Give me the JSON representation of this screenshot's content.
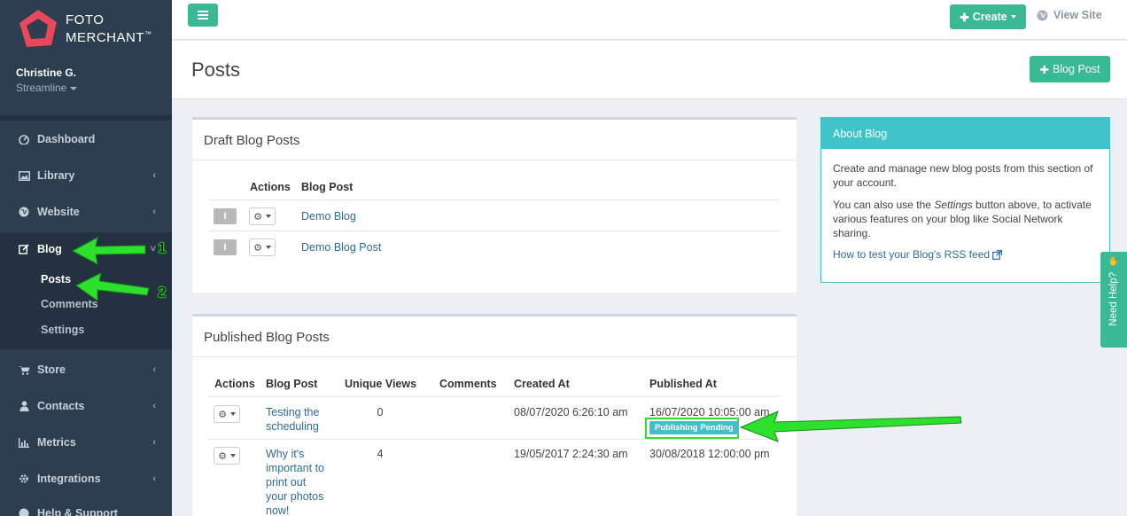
{
  "brand": {
    "line1": "FOTO",
    "line2": "MERCHANT",
    "tm": "™",
    "color": "#e8485a"
  },
  "user": {
    "name": "Christine G.",
    "plan": "Streamline"
  },
  "sidebar": {
    "items": [
      {
        "label": "Dashboard",
        "icon": "dashboard-icon",
        "chevron": ""
      },
      {
        "label": "Library",
        "icon": "picture-icon",
        "chevron": "‹"
      },
      {
        "label": "Website",
        "icon": "globe-icon",
        "chevron": "‹"
      },
      {
        "label": "Blog",
        "icon": "edit-icon",
        "chevron": "˅"
      },
      {
        "label": "Store",
        "icon": "cart-icon",
        "chevron": "‹"
      },
      {
        "label": "Contacts",
        "icon": "user-icon",
        "chevron": "‹"
      },
      {
        "label": "Metrics",
        "icon": "bar-chart-icon",
        "chevron": "‹"
      },
      {
        "label": "Integrations",
        "icon": "gear-icon",
        "chevron": "‹"
      },
      {
        "label": "Help & Support",
        "icon": "help-icon",
        "chevron": ""
      }
    ],
    "blog_sub": [
      "Posts",
      "Comments",
      "Settings"
    ]
  },
  "topbar": {
    "create_label": "Create",
    "view_site_label": "View Site"
  },
  "page": {
    "title": "Posts",
    "blog_post_button": "Blog Post"
  },
  "drafts": {
    "title": "Draft Blog Posts",
    "columns": [
      "Actions",
      "Blog Post"
    ],
    "rows": [
      {
        "post": "Demo Blog"
      },
      {
        "post": "Demo Blog Post"
      }
    ]
  },
  "published": {
    "title": "Published Blog Posts",
    "columns": [
      "Actions",
      "Blog Post",
      "Unique Views",
      "Comments",
      "Created At",
      "Published At"
    ],
    "rows": [
      {
        "post": "Testing the scheduling",
        "views": "0",
        "comments": "",
        "created": "08/07/2020 6:26:10 am",
        "published": "16/07/2020 10:05:00 am",
        "badge": "Publishing Pending"
      },
      {
        "post": "Why it's important to print out your photos now!",
        "views": "4",
        "comments": "",
        "created": "19/05/2017 2:24:30 am",
        "published": "30/08/2018 12:00:00 pm",
        "badge": ""
      }
    ]
  },
  "about": {
    "title": "About Blog",
    "p1": "Create and manage new blog posts from this section of your account.",
    "p2_before": "You can also use the ",
    "p2_em": "Settings",
    "p2_after": " button above, to activate various features on your blog like Social Network sharing.",
    "link": "How to test your Blog's RSS feed"
  },
  "need_help": "Need Help?",
  "annotations": {
    "arrow1": "1",
    "arrow2": "2",
    "color": "#2de02d"
  },
  "colors": {
    "sidebar": "#2c3e50",
    "accent": "#3bb894",
    "info": "#40c4c9",
    "link": "#2f6b9a"
  }
}
